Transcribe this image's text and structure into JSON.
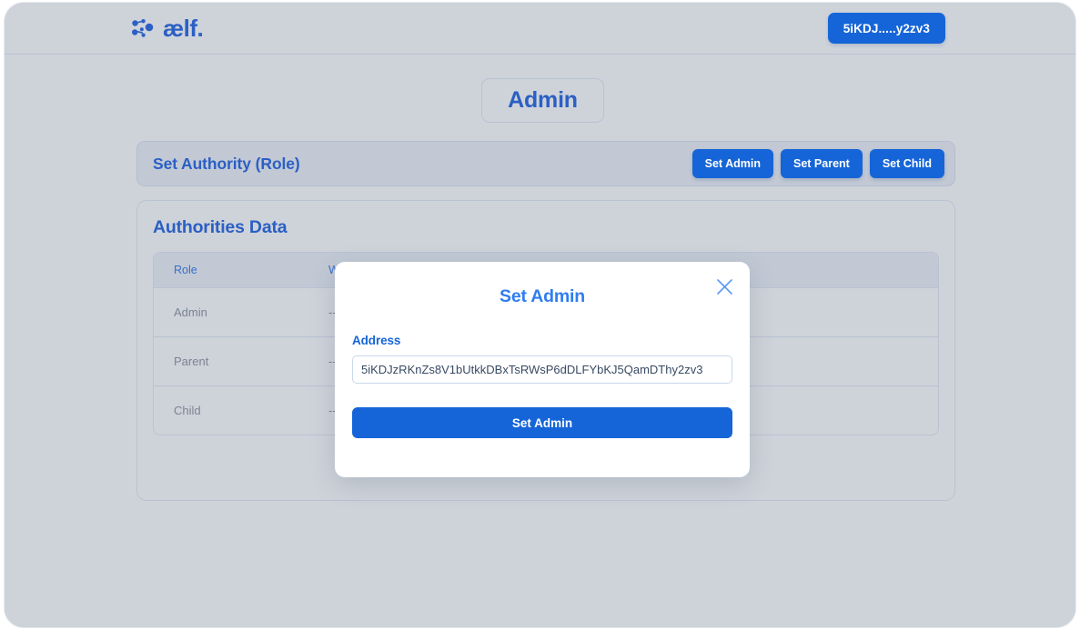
{
  "topbar": {
    "brand_text": "ælf.",
    "brand_icon": "aelf-nodes-logo-icon",
    "wallet_button_label": "5iKDJ.....y2zv3"
  },
  "page": {
    "title": "Admin"
  },
  "authority_section": {
    "title": "Set Authority (Role)",
    "buttons": [
      {
        "label": "Set Admin"
      },
      {
        "label": "Set Parent"
      },
      {
        "label": "Set Child"
      }
    ]
  },
  "authorities_data": {
    "title": "Authorities Data",
    "columns": [
      "Role",
      "Wallet Address"
    ],
    "rows": [
      {
        "role": "Admin",
        "wallet": "---"
      },
      {
        "role": "Parent",
        "wallet": "---"
      },
      {
        "role": "Child",
        "wallet": "---"
      }
    ]
  },
  "modal": {
    "title": "Set Admin",
    "close_icon": "close-x-icon",
    "field_label": "Address",
    "address_value": "5iKDJzRKnZs8V1bUtkkDBxTsRWsP6dDLFYbKJ5QamDThy2zv3",
    "address_placeholder": "Address",
    "submit_label": "Set Admin"
  },
  "colors": {
    "brand_blue": "#2b5fc4",
    "button_blue": "#1565d8",
    "modal_title_blue": "#2f7df0",
    "page_bg": "#ced3da",
    "card_bg": "#c2c9d5",
    "border": "#b9c2d2"
  }
}
